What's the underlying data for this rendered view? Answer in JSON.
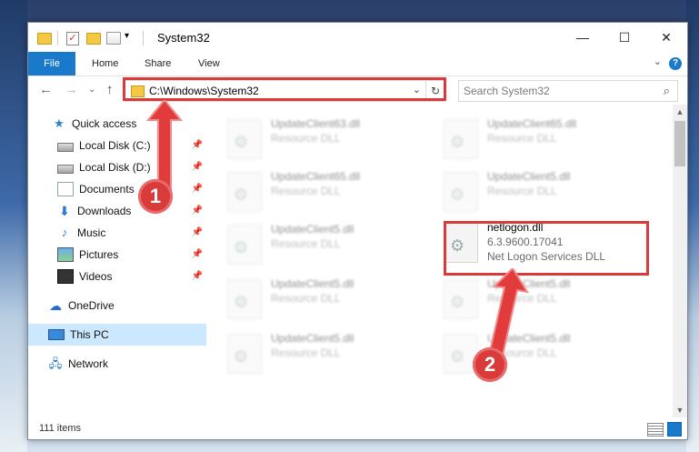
{
  "window": {
    "title": "System32",
    "controls": {
      "minimize": "—",
      "maximize": "☐",
      "close": "✕"
    }
  },
  "ribbon": {
    "tabs": [
      "File",
      "Home",
      "Share",
      "View"
    ],
    "help": "?"
  },
  "address": {
    "path": "C:\\Windows\\System32",
    "search_placeholder": "Search System32"
  },
  "nav": {
    "items": [
      {
        "label": "Quick access",
        "icon": "star-icon",
        "pinned": false
      },
      {
        "label": "Local Disk (C:)",
        "icon": "disk-icon",
        "pinned": true
      },
      {
        "label": "Local Disk (D:)",
        "icon": "disk-icon",
        "pinned": true
      },
      {
        "label": "Documents",
        "icon": "documents-icon",
        "pinned": true
      },
      {
        "label": "Downloads",
        "icon": "downloads-icon",
        "pinned": true
      },
      {
        "label": "Music",
        "icon": "music-icon",
        "pinned": true
      },
      {
        "label": "Pictures",
        "icon": "pictures-icon",
        "pinned": true
      },
      {
        "label": "Videos",
        "icon": "videos-icon",
        "pinned": true
      },
      {
        "label": "OneDrive",
        "icon": "onedrive-icon",
        "pinned": false
      },
      {
        "label": "This PC",
        "icon": "this-pc-icon",
        "pinned": false,
        "selected": true
      },
      {
        "label": "Network",
        "icon": "network-icon",
        "pinned": false
      }
    ]
  },
  "files": [
    {
      "name": "UpdateClient63.dll",
      "sub": "Resource DLL"
    },
    {
      "name": "UpdateClient65.dll",
      "sub": "Resource DLL"
    },
    {
      "name": "UpdateClient65.dll",
      "sub": "Resource DLL"
    },
    {
      "name": "UpdateClient5.dll",
      "sub": "Resource DLL"
    },
    {
      "name": "UpdateClient5.dll",
      "sub": "Resource DLL"
    },
    {
      "name": "netlogon.dll",
      "version": "6.3.9600.17041",
      "description": "Net Logon Services DLL"
    },
    {
      "name": "UpdateClient5.dll",
      "sub": "Resource DLL"
    },
    {
      "name": "UpdateClient5.dll",
      "sub": "Resource DLL"
    },
    {
      "name": "UpdateClient5.dll",
      "sub": "Resource DLL"
    },
    {
      "name": "UpdateClient5.dll",
      "sub": "Resource DLL"
    }
  ],
  "status": {
    "count": "111 items"
  },
  "annotations": {
    "step1": "1",
    "step2": "2"
  },
  "colors": {
    "accent": "#1979ca",
    "highlight": "#d93a3a",
    "selected_nav": "#cce8ff"
  }
}
